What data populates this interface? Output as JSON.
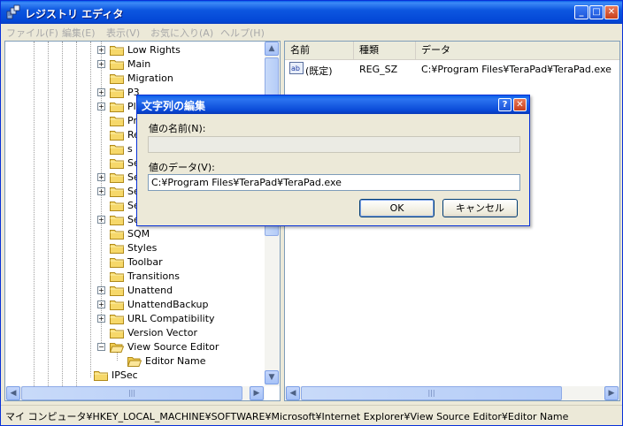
{
  "window": {
    "title": "レジストリ エディタ"
  },
  "menu": [
    "ファイル(F)",
    "編集(E)",
    "表示(V)",
    "お気に入り(A)",
    "ヘルプ(H)"
  ],
  "tree": {
    "items": [
      {
        "label": "Low Rights",
        "expander": "+"
      },
      {
        "label": "Main",
        "expander": "+"
      },
      {
        "label": "Migration",
        "expander": ""
      },
      {
        "label": "P3",
        "expander": "+"
      },
      {
        "label": "Pl",
        "expander": "+"
      },
      {
        "label": "Pr",
        "expander": ""
      },
      {
        "label": "Re",
        "expander": ""
      },
      {
        "label": "s",
        "expander": ""
      },
      {
        "label": "Se",
        "expander": ""
      },
      {
        "label": "Se",
        "expander": "+"
      },
      {
        "label": "Se",
        "expander": "+"
      },
      {
        "label": "Se",
        "expander": ""
      },
      {
        "label": "Se",
        "expander": "+"
      },
      {
        "label": "SQM",
        "expander": ""
      },
      {
        "label": "Styles",
        "expander": ""
      },
      {
        "label": "Toolbar",
        "expander": ""
      },
      {
        "label": "Transitions",
        "expander": ""
      },
      {
        "label": "Unattend",
        "expander": "+"
      },
      {
        "label": "UnattendBackup",
        "expander": "+"
      },
      {
        "label": "URL Compatibility",
        "expander": "+"
      },
      {
        "label": "Version Vector",
        "expander": ""
      },
      {
        "label": "View Source Editor",
        "expander": "−"
      }
    ],
    "child": "Editor Name",
    "sibling": "IPSec"
  },
  "list": {
    "headers": [
      "名前",
      "種類",
      "データ"
    ],
    "rows": [
      {
        "name": "(既定)",
        "type": "REG_SZ",
        "data": "C:¥Program Files¥TeraPad¥TeraPad.exe",
        "icon": "string-value-icon"
      }
    ]
  },
  "status": "マイ コンピュータ¥HKEY_LOCAL_MACHINE¥SOFTWARE¥Microsoft¥Internet Explorer¥View Source Editor¥Editor Name",
  "dialog": {
    "title": "文字列の編集",
    "name_label": "値の名前(N):",
    "name_value": "",
    "data_label": "値のデータ(V):",
    "data_value": "C:¥Program Files¥TeraPad¥TeraPad.exe",
    "ok": "OK",
    "cancel": "キャンセル",
    "help_glyph": "?",
    "close_glyph": "✕"
  },
  "titlebar_buttons": {
    "minimize": "_",
    "maximize": "□",
    "close": "✕"
  },
  "scroll_glyphs": {
    "up": "▲",
    "down": "▼",
    "left": "◀",
    "right": "▶",
    "grip": "|||"
  }
}
